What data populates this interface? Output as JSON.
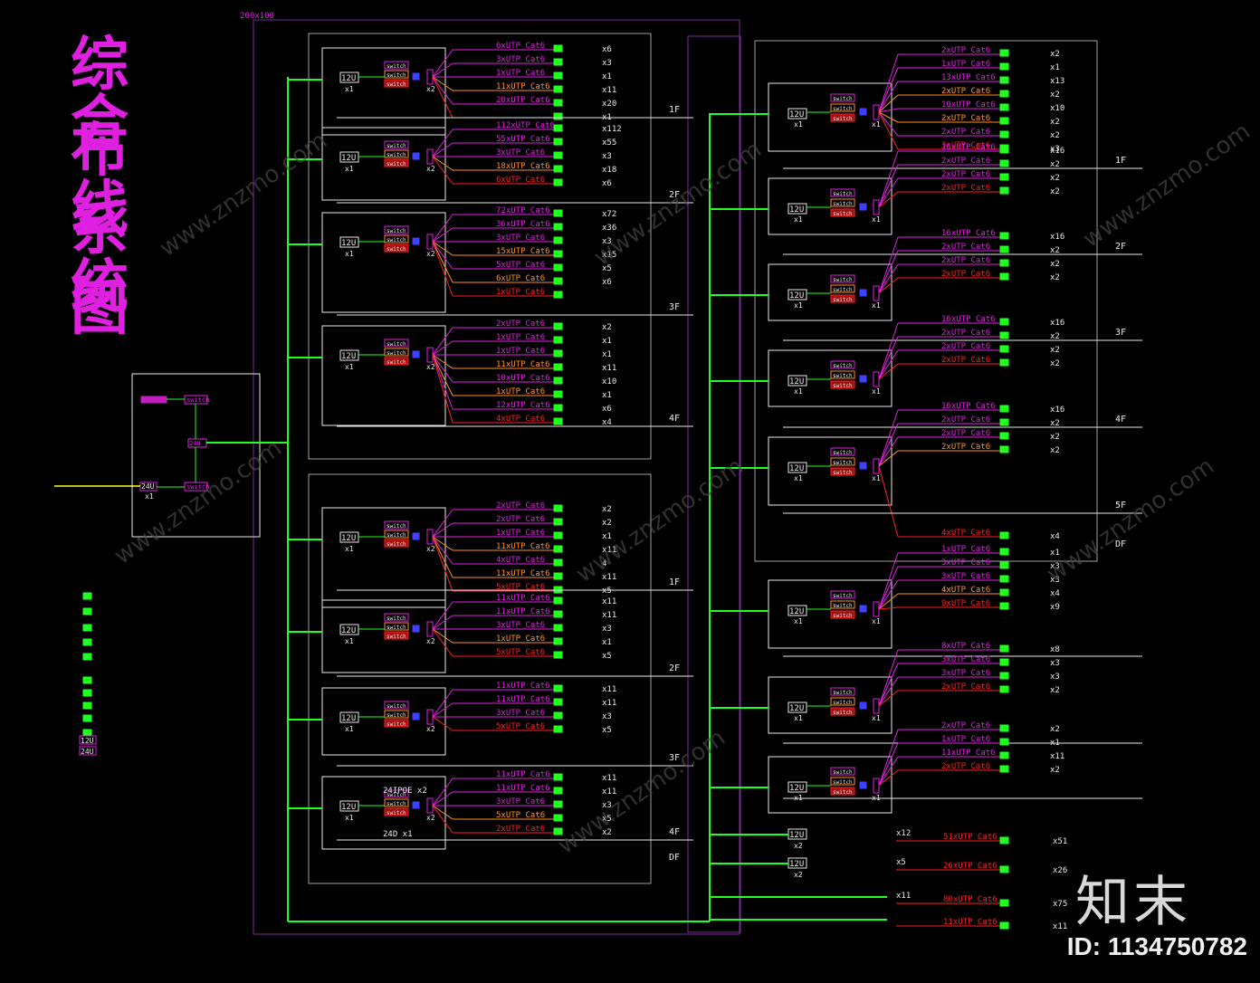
{
  "title": [
    "综",
    "合",
    "布",
    "线",
    "系",
    "统",
    "图"
  ],
  "title_lines": [
    "综合",
    "布线",
    "系统",
    "图"
  ],
  "top_label": "200x100",
  "colors": {
    "magenta": "#e020e0",
    "green": "#20ff20",
    "red": "#ff2020",
    "orange": "#ff9020",
    "yellow": "#ffff20",
    "white": "#e8e8e8",
    "purple_frame": "#7a2a9a",
    "grey_frame": "#a0a0a0"
  },
  "core": {
    "switch_label": "switch",
    "u_label_1": "24U",
    "u_label_2": "24U",
    "qty": "x1"
  },
  "left_blocks": [
    {
      "floor": "1F",
      "u": "12U",
      "qty": "x1",
      "rows": [
        {
          "cable": "6xUTP Cat6",
          "qty": "x6"
        },
        {
          "cable": "3xUTP Cat6",
          "qty": "x3"
        },
        {
          "cable": "1xUTP Cat6",
          "qty": "x1"
        },
        {
          "cable": "11xUTP Cat6",
          "qty": "x11"
        },
        {
          "cable": "20xUTP Cat6",
          "qty": "x20"
        },
        {
          "cable": "",
          "qty": "x1"
        }
      ]
    },
    {
      "floor": "2F",
      "u": "12U",
      "qty": "x1",
      "rows": [
        {
          "cable": "112xUTP Cat6",
          "qty": "x112"
        },
        {
          "cable": "55xUTP Cat6",
          "qty": "x55"
        },
        {
          "cable": "3xUTP Cat6",
          "qty": "x3"
        },
        {
          "cable": "18xUTP Cat6",
          "qty": "x18"
        },
        {
          "cable": "6xUTP Cat6",
          "qty": "x6"
        }
      ]
    },
    {
      "floor": "3F",
      "u": "12U",
      "qty": "x1",
      "rows": [
        {
          "cable": "72xUTP Cat6",
          "qty": "x72"
        },
        {
          "cable": "36xUTP Cat6",
          "qty": "x36"
        },
        {
          "cable": "3xUTP Cat6",
          "qty": "x3"
        },
        {
          "cable": "15xUTP Cat6",
          "qty": "x15"
        },
        {
          "cable": "5xUTP Cat6",
          "qty": "x5"
        },
        {
          "cable": "6xUTP Cat6",
          "qty": "x6"
        },
        {
          "cable": "1xUTP Cat6",
          "qty": ""
        }
      ]
    },
    {
      "floor": "4F",
      "u": "12U",
      "qty": "x1",
      "rows": [
        {
          "cable": "2xUTP Cat6",
          "qty": "x2"
        },
        {
          "cable": "1xUTP Cat6",
          "qty": "x1"
        },
        {
          "cable": "1xUTP Cat6",
          "qty": "x1"
        },
        {
          "cable": "11xUTP Cat6",
          "qty": "x11"
        },
        {
          "cable": "10xUTP Cat6",
          "qty": "x10"
        },
        {
          "cable": "1xUTP Cat6",
          "qty": "x1"
        },
        {
          "cable": "12xUTP Cat6",
          "qty": "x6"
        },
        {
          "cable": "4xUTP Cat6",
          "qty": "x4"
        }
      ]
    },
    {
      "floor": "1F",
      "u": "12U",
      "qty": "x1",
      "rows": [
        {
          "cable": "2xUTP Cat6",
          "qty": "x2"
        },
        {
          "cable": "2xUTP Cat6",
          "qty": "x2"
        },
        {
          "cable": "1xUTP Cat6",
          "qty": "x1"
        },
        {
          "cable": "11xUTP Cat6",
          "qty": "x11"
        },
        {
          "cable": "4xUTP Cat6",
          "qty": "4"
        },
        {
          "cable": "11xUTP Cat6",
          "qty": "x11"
        },
        {
          "cable": "5xUTP Cat6",
          "qty": "x5"
        }
      ]
    },
    {
      "floor": "2F",
      "u": "12U",
      "qty": "x1",
      "rows": [
        {
          "cable": "11xUTP Cat6",
          "qty": "x11"
        },
        {
          "cable": "11xUTP Cat6",
          "qty": "x11"
        },
        {
          "cable": "3xUTP Cat6",
          "qty": "x3"
        },
        {
          "cable": "1xUTP Cat6",
          "qty": "x1"
        },
        {
          "cable": "5xUTP Cat6",
          "qty": "x5"
        }
      ]
    },
    {
      "floor": "3F",
      "u": "12U",
      "qty": "x1",
      "rows": [
        {
          "cable": "11xUTP Cat6",
          "qty": "x11"
        },
        {
          "cable": "11xUTP Cat6",
          "qty": "x11"
        },
        {
          "cable": "3xUTP Cat6",
          "qty": "x3"
        },
        {
          "cable": "5xUTP Cat6",
          "qty": "x5"
        }
      ]
    },
    {
      "floor": "4F",
      "u": "12U",
      "qty": "x1",
      "extra": "24IPOE x2",
      "extra2": "24D x1",
      "rows": [
        {
          "cable": "11xUTP Cat6",
          "qty": "x11"
        },
        {
          "cable": "11xUTP Cat6",
          "qty": "x11"
        },
        {
          "cable": "3xUTP Cat6",
          "qty": "x3"
        },
        {
          "cable": "5xUTP Cat6",
          "qty": "x5"
        },
        {
          "cable": "2xUTP Cat6",
          "qty": "x2"
        }
      ]
    }
  ],
  "left_df": [
    "DF"
  ],
  "right_blocks": [
    {
      "floor": "1F",
      "u": "12U",
      "qty": "x1",
      "rows": [
        {
          "cable": "2xUTP Cat6",
          "qty": "x2"
        },
        {
          "cable": "1xUTP Cat6",
          "qty": "x1"
        },
        {
          "cable": "13xUTP Cat6",
          "qty": "x13"
        },
        {
          "cable": "2xUTP Cat6",
          "qty": "x2"
        },
        {
          "cable": "10xUTP Cat6",
          "qty": "x10"
        },
        {
          "cable": "2xUTP Cat6",
          "qty": "x2"
        },
        {
          "cable": "2xUTP Cat6",
          "qty": "x2"
        },
        {
          "cable": "3xUTP Cat6",
          "qty": "x3"
        }
      ]
    },
    {
      "floor": "2F",
      "u": "12U",
      "qty": "x1",
      "rows": [
        {
          "cable": "16xUTP Cat6",
          "qty": "x16"
        },
        {
          "cable": "2xUTP Cat6",
          "qty": "x2"
        },
        {
          "cable": "2xUTP Cat6",
          "qty": "x2"
        },
        {
          "cable": "2xUTP Cat6",
          "qty": "x2"
        }
      ]
    },
    {
      "floor": "3F",
      "u": "12U",
      "qty": "x1",
      "rows": [
        {
          "cable": "16xUTP Cat6",
          "qty": "x16"
        },
        {
          "cable": "2xUTP Cat6",
          "qty": "x2"
        },
        {
          "cable": "2xUTP Cat6",
          "qty": "x2"
        },
        {
          "cable": "2xUTP Cat6",
          "qty": "x2"
        }
      ]
    },
    {
      "floor": "4F",
      "u": "12U",
      "qty": "x1",
      "rows": [
        {
          "cable": "16xUTP Cat6",
          "qty": "x16"
        },
        {
          "cable": "2xUTP Cat6",
          "qty": "x2"
        },
        {
          "cable": "2xUTP Cat6",
          "qty": "x2"
        },
        {
          "cable": "2xUTP Cat6",
          "qty": "x2"
        }
      ]
    },
    {
      "floor": "5F",
      "u": "12U",
      "qty": "x1",
      "rows": [
        {
          "cable": "16xUTP Cat6",
          "qty": "x16"
        },
        {
          "cable": "2xUTP Cat6",
          "qty": "x2"
        },
        {
          "cable": "2xUTP Cat6",
          "qty": "x2"
        },
        {
          "cable": "2xUTP Cat6",
          "qty": "x2"
        },
        {
          "cable": "4xUTP Cat6",
          "qty": "x4"
        }
      ]
    },
    {
      "floor": "",
      "u": "12U",
      "qty": "x1",
      "rows": [
        {
          "cable": "1xUTP Cat6",
          "qty": "x1"
        },
        {
          "cable": "3xUTP Cat6",
          "qty": "x3"
        },
        {
          "cable": "3xUTP Cat6",
          "qty": "x3"
        },
        {
          "cable": "4xUTP Cat6",
          "qty": "x4"
        },
        {
          "cable": "9xUTP Cat6",
          "qty": "x9"
        }
      ]
    },
    {
      "floor": "",
      "u": "12U",
      "qty": "x1",
      "rows": [
        {
          "cable": "8xUTP Cat6",
          "qty": "x8"
        },
        {
          "cable": "3xUTP Cat6",
          "qty": "x3"
        },
        {
          "cable": "3xUTP Cat6",
          "qty": "x3"
        },
        {
          "cable": "2xUTP Cat6",
          "qty": "x2"
        }
      ]
    },
    {
      "floor": "",
      "u": "12U",
      "qty": "x1",
      "rows": [
        {
          "cable": "2xUTP Cat6",
          "qty": "x2"
        },
        {
          "cable": "1xUTP Cat6",
          "qty": "x1"
        },
        {
          "cable": "11xUTP Cat6",
          "qty": "x11"
        },
        {
          "cable": "2xUTP Cat6",
          "qty": "x2"
        }
      ]
    }
  ],
  "right_df": "DF",
  "bottom_rows": [
    {
      "u": "12U",
      "qty": "x2",
      "count": "x12",
      "cable": "51xUTP Cat6",
      "qty2": "x51"
    },
    {
      "u": "12U",
      "qty": "x2",
      "count": "x5",
      "cable": "26xUTP Cat6",
      "qty2": "x26"
    },
    {
      "u": "",
      "qty": "",
      "count": "x11",
      "cable": "80xUTP Cat6",
      "qty2": "x75"
    },
    {
      "u": "",
      "qty": "",
      "count": "",
      "cable": "11xUTP Cat6",
      "qty2": "x11"
    }
  ],
  "poe_note": "POE",
  "watermark": "www.znzmo.com",
  "brand": "知末",
  "brand_id": "ID: 1134750782",
  "legend_labels": [
    "12U",
    "24U"
  ]
}
